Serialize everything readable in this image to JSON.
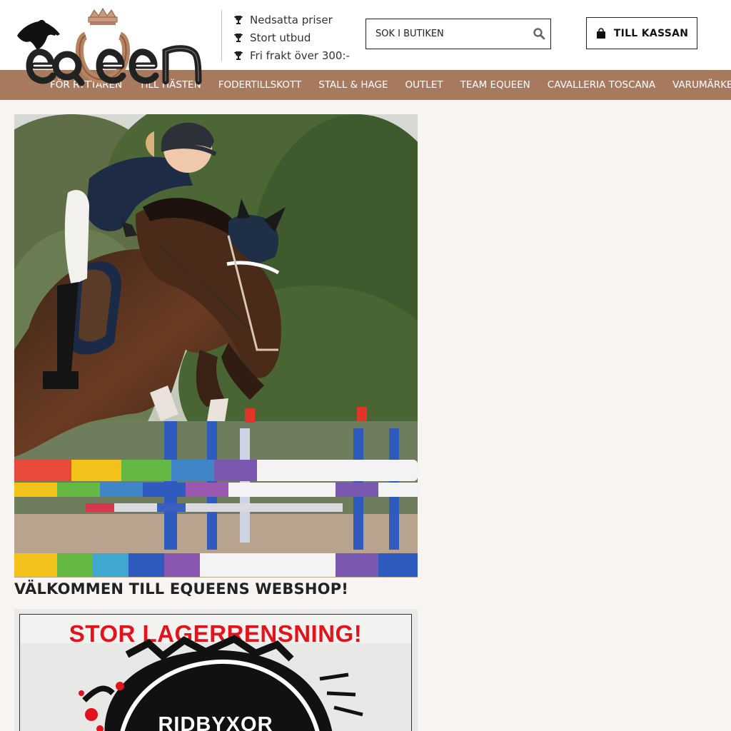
{
  "brand": {
    "name": "EQUEEN"
  },
  "usps": [
    {
      "icon": "trophy-icon",
      "text": "Nedsatta priser"
    },
    {
      "icon": "trophy-icon",
      "text": "Stort utbud"
    },
    {
      "icon": "trophy-icon",
      "text": "Fri frakt över 300:-"
    }
  ],
  "search": {
    "placeholder": "SÖK I BUTIKEN",
    "value": "",
    "icon": "search-icon"
  },
  "cart": {
    "label": "TILL KASSAN",
    "icon": "shopping-bag-icon"
  },
  "nav": {
    "items": [
      {
        "label": "FÖR RYTTAREN"
      },
      {
        "label": "TILL HÄSTEN"
      },
      {
        "label": "FODERTILLSKOTT"
      },
      {
        "label": "STALL & HAGE"
      },
      {
        "label": "OUTLET"
      },
      {
        "label": "TEAM EQUEEN"
      },
      {
        "label": "CAVALLERIA TOSCANA"
      },
      {
        "label": "VARUMÄRKEN"
      }
    ]
  },
  "main": {
    "welcome_title": "VÄLKOMMEN TILL EQUEENS WEBSHOP!",
    "banner": {
      "title": "STOR LAGERRENSNING!",
      "subtitle": "RIDBYXOR"
    }
  },
  "colors": {
    "nav_bg": "#a77a60",
    "page_bg": "#f8f4f1",
    "banner_red": "#e3131b",
    "logo_copper": "#b9835f"
  }
}
